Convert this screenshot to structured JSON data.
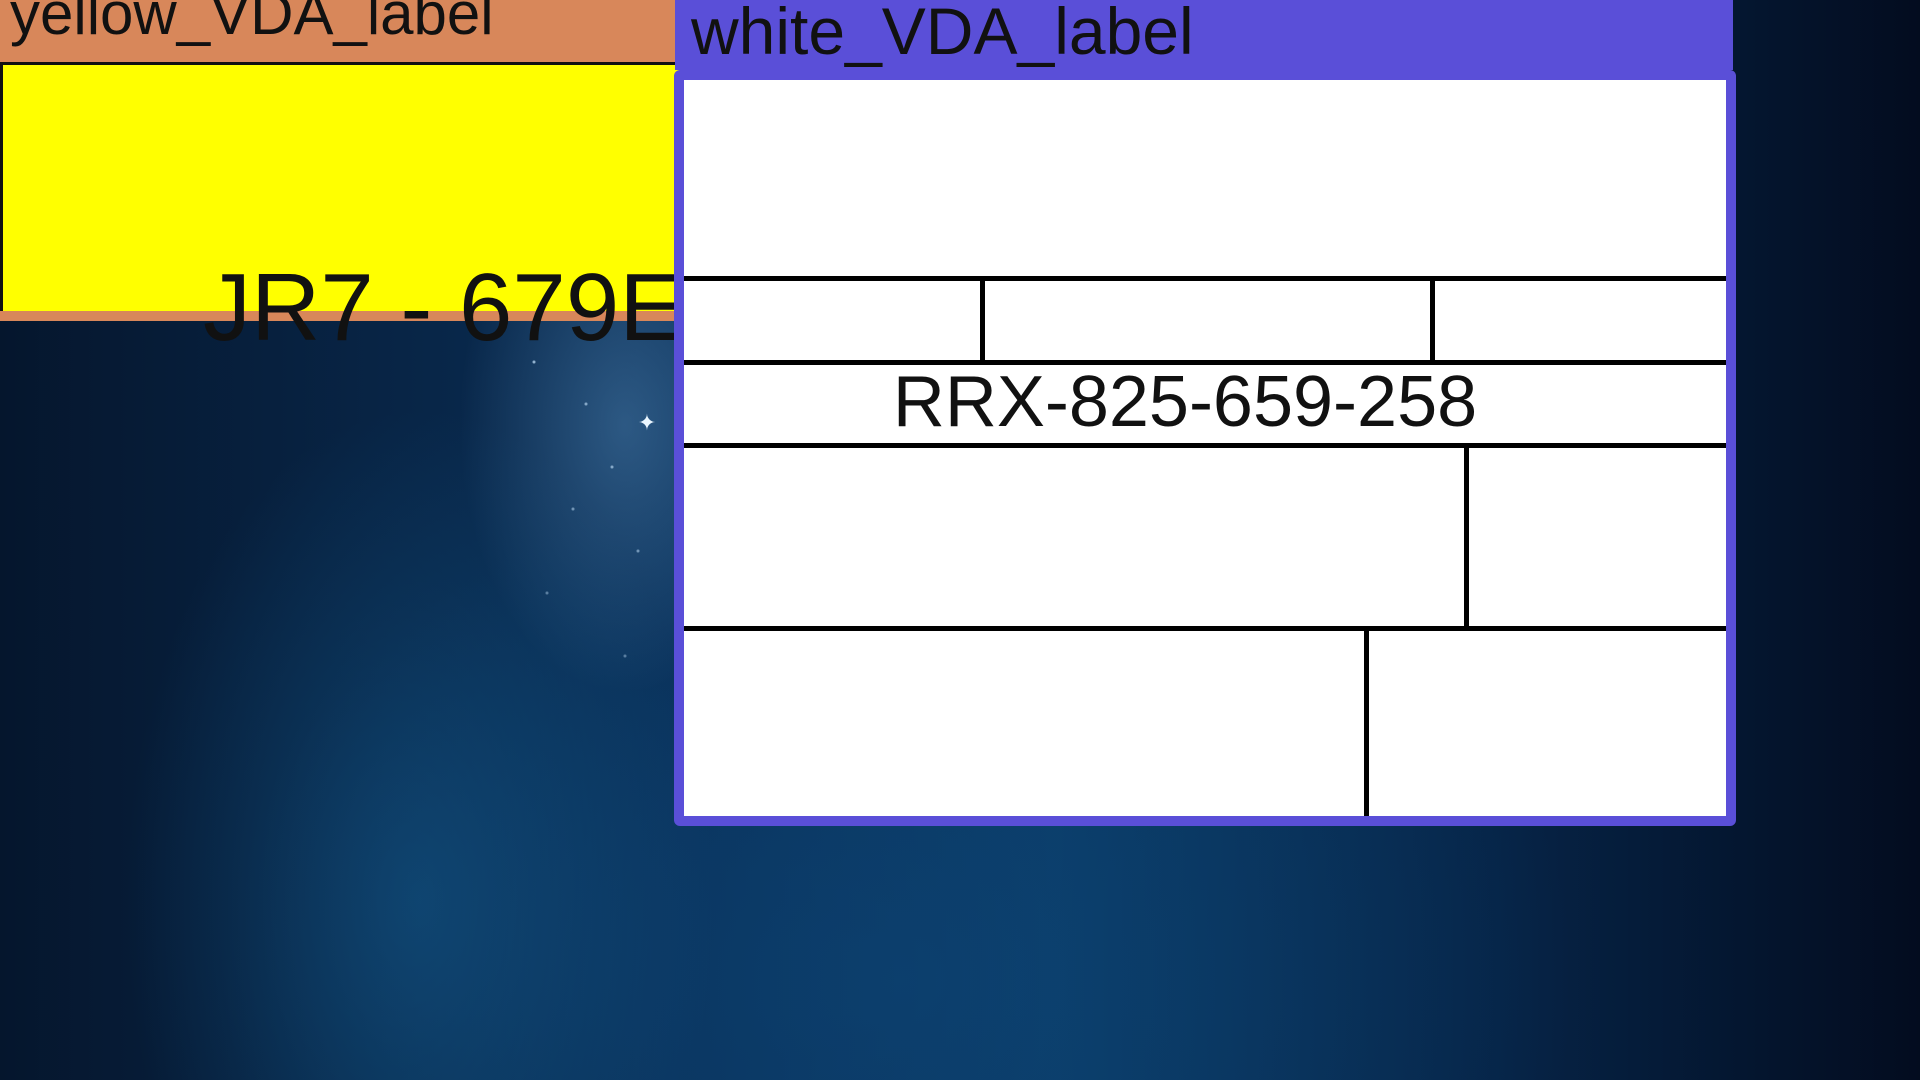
{
  "desktop": {
    "background": "blue-space-wallpaper",
    "sparkle_icon": "star-sparkle"
  },
  "windows": {
    "yellow": {
      "title": "yellow_VDA_label",
      "code": "JR7 - 679E",
      "title_bar_color": "#d8875a",
      "body_color": "#ffff00"
    },
    "white": {
      "title": "white_VDA_label",
      "code": "RRX-825-659-258",
      "frame_color": "#5a4fd8",
      "body_color": "#ffffff"
    }
  }
}
